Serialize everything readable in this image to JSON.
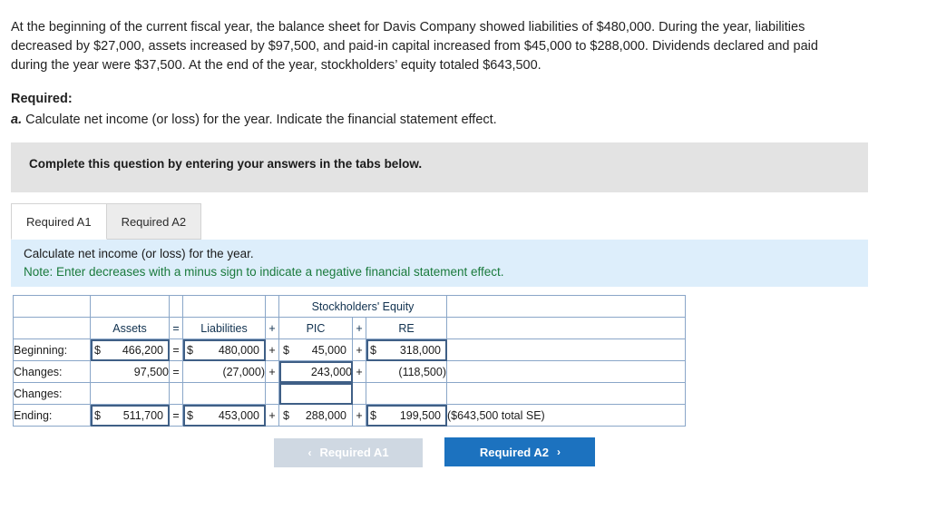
{
  "problem": {
    "text": "At the beginning of the current fiscal year, the balance sheet for Davis Company showed liabilities of $480,000. During the year, liabilities decreased by $27,000, assets increased by $97,500, and paid-in capital increased from $45,000 to $288,000. Dividends declared and paid during the year were $37,500. At the end of the year, stockholders’ equity totaled $643,500."
  },
  "required": {
    "title": "Required:",
    "letter": "a.",
    "text": "Calculate net income (or loss) for the year. Indicate the financial statement effect."
  },
  "banner": {
    "text": "Complete this question by entering your answers in the tabs below."
  },
  "tabs": [
    {
      "label": "Required A1",
      "active": true
    },
    {
      "label": "Required A2",
      "active": false
    }
  ],
  "note": {
    "line1": "Calculate net income (or loss) for the year.",
    "line2": "Note: Enter decreases with a minus sign to indicate a negative financial statement effect."
  },
  "sheet": {
    "group_header": "Stockholders' Equity",
    "columns": {
      "assets": "Assets",
      "eq": "=",
      "liabilities": "Liabilities",
      "plus1": "+",
      "pic": "PIC",
      "plus2": "+",
      "re": "RE"
    },
    "rows": [
      {
        "label": "Beginning:",
        "assets_sign": "$",
        "assets": "466,200",
        "eq": "=",
        "liab_sign": "$",
        "liabilities": "480,000",
        "op1": "+",
        "pic_sign": "$",
        "pic": "45,000",
        "op2": "+",
        "re_sign": "$",
        "re": "318,000",
        "tail": ""
      },
      {
        "label": "Changes:",
        "assets_sign": "",
        "assets": "97,500",
        "eq": "=",
        "liab_sign": "",
        "liabilities": "(27,000)",
        "op1": "+",
        "pic_sign": "",
        "pic": "243,000",
        "op2": "+",
        "re_sign": "",
        "re": "(118,500)",
        "tail": ""
      },
      {
        "label": "Changes:",
        "assets_sign": "",
        "assets": "",
        "eq": "",
        "liab_sign": "",
        "liabilities": "",
        "op1": "",
        "pic_sign": "",
        "pic": "",
        "op2": "",
        "re_sign": "",
        "re": "",
        "tail": ""
      },
      {
        "label": "Ending:",
        "assets_sign": "$",
        "assets": "511,700",
        "eq": "=",
        "liab_sign": "$",
        "liabilities": "453,000",
        "op1": "+",
        "pic_sign": "$",
        "pic": "288,000",
        "op2": "+",
        "re_sign": "$",
        "re": "199,500",
        "tail": "($643,500 total SE)"
      }
    ]
  },
  "buttons": {
    "prev_label": "Required A1",
    "prev_chevron": "‹",
    "next_label": "Required A2",
    "next_chevron": "›"
  }
}
